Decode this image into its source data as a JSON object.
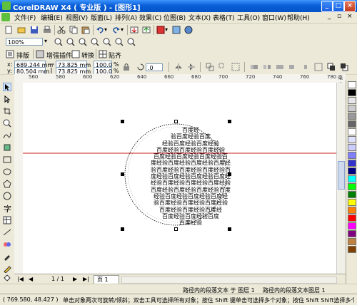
{
  "window": {
    "title": "CorelDRAW X4 ( 专业版 ) - [图形1]"
  },
  "menu": [
    "文件(F)",
    "编辑(E)",
    "视图(V)",
    "版面(L)",
    "排列(A)",
    "效果(C)",
    "位图(B)",
    "文本(X)",
    "表格(T)",
    "工具(O)",
    "窗口(W)",
    "帮助(H)"
  ],
  "menu_window_controls": [
    "_",
    "▫",
    "×"
  ],
  "standard_toolbar": {
    "zoom_value": "100%"
  },
  "custom_toolbar": {
    "items": [
      "排版",
      "增强插件",
      "转换",
      "贴齐"
    ]
  },
  "property_bar": {
    "x": "689.244 mm",
    "y": "80.504 mm",
    "width": "73.825 mm",
    "height": "73.825 mm",
    "scale_x": "100.0",
    "scale_y": "100.0",
    "percent": "%",
    "rotation": ".0",
    "x_label": "x:",
    "y_label": "y:"
  },
  "ruler": {
    "ticks": [
      "560",
      "580",
      "600",
      "620",
      "640",
      "660",
      "680",
      "700",
      "720",
      "740",
      "760",
      "780"
    ],
    "unit": "毫米"
  },
  "document": {
    "text_lines": [
      "百度经",
      "验百度经验百度",
      "经验百度经验百度经验",
      "百度经验百度经验百度经验",
      "百度经验百度经验百度经验百",
      "度经验百度经验百度经验百度经",
      "验百度经验百度经验百度经验百",
      "度经验百度经验百度经验百度经",
      "经验百度经验百度经验百度经验",
      "百度经验百度经验百度经验百度",
      "经验百度经验百度经验百度经",
      "验百度经验百度经验百度经验",
      "百度经验百度经验百度经",
      "百度经验百度经验百度",
      "百度经验"
    ]
  },
  "pagebar": {
    "page_count": "1 / 1",
    "page_tab": "页 1"
  },
  "info": {
    "left": "路径内的段落文本 于 图层 1",
    "right": "路径内的段落文本图层 1"
  },
  "status": {
    "coords": "( 769.580, 48.427 )",
    "hint": "单击对象两次可旋转/倾斜；双击工具可选择所有对象；按住 Shift 键单击可选择多个对象；按住 Shift Shift选择多个对"
  },
  "palette_colors": [
    "#ffffff",
    "#000000",
    "#e6e6e6",
    "#cccccc",
    "#999999",
    "#666666",
    "#ffffff",
    "#e0e0ff",
    "#ccccff",
    "#8080ff",
    "#3333cc",
    "#000080",
    "#00ffff",
    "#00ff00",
    "#008000",
    "#ffff00",
    "#ff8000",
    "#ff0000",
    "#ff00ff",
    "#800080",
    "#c08040",
    "#804000"
  ]
}
